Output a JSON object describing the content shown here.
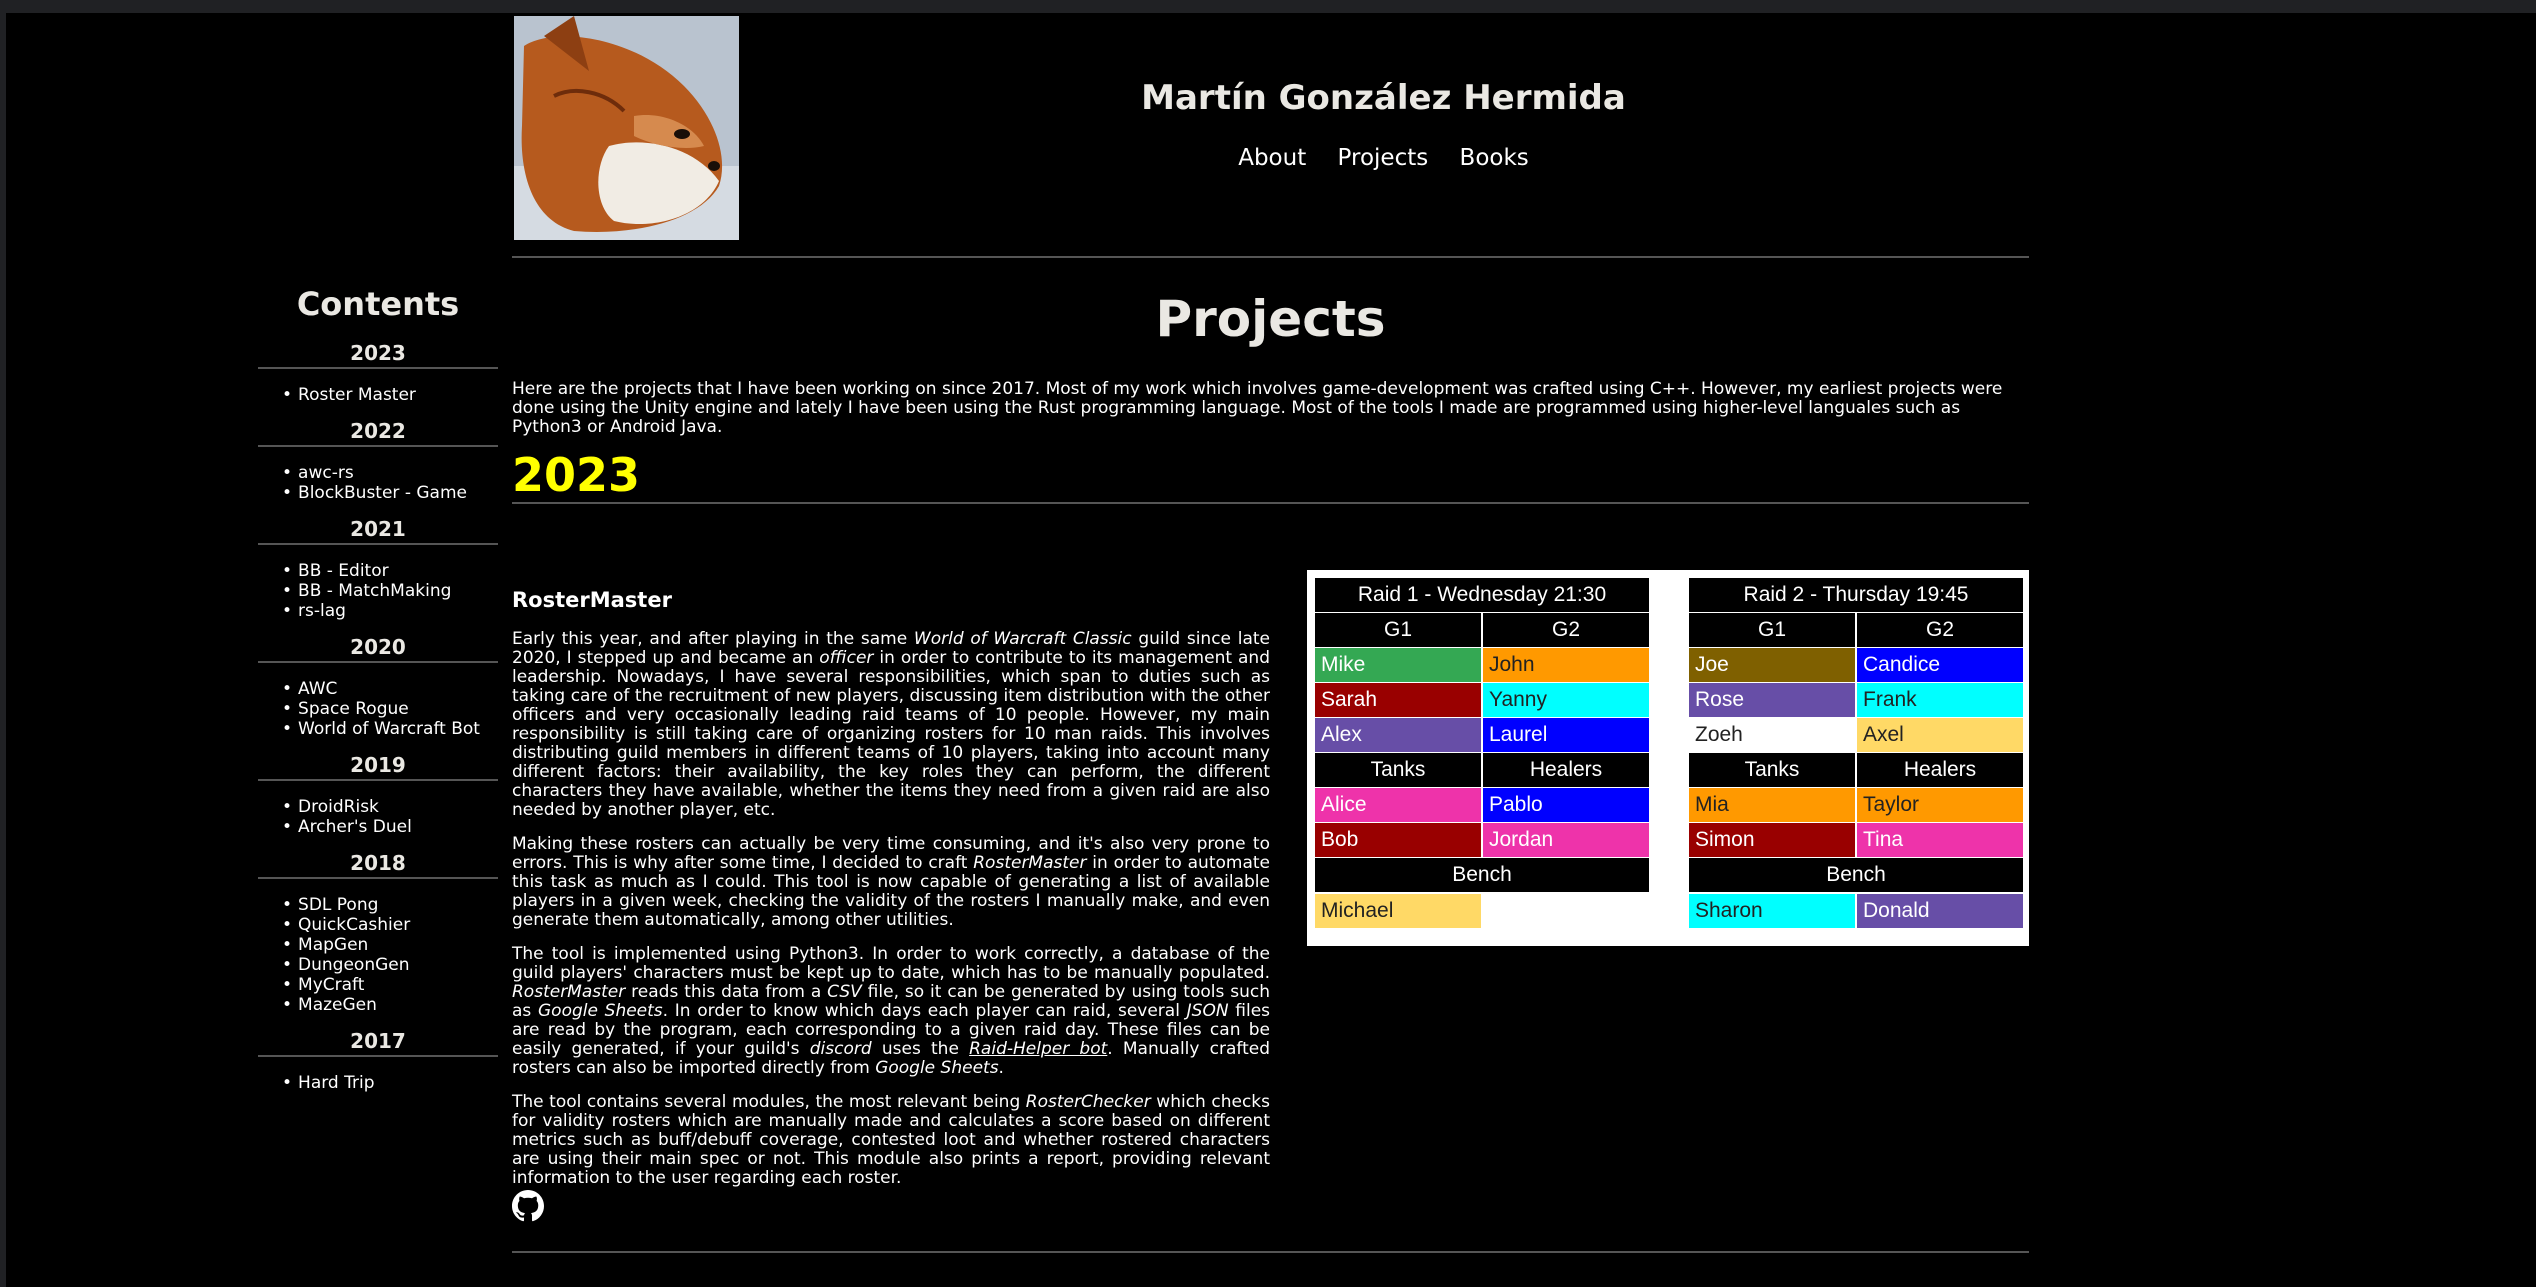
{
  "header": {
    "site_title": "Martín González Hermida",
    "nav": [
      "About",
      "Projects",
      "Books"
    ]
  },
  "sidebar": {
    "title": "Contents",
    "years": [
      {
        "year": "2023",
        "items": [
          "Roster Master"
        ]
      },
      {
        "year": "2022",
        "items": [
          "awc-rs",
          "BlockBuster - Game"
        ]
      },
      {
        "year": "2021",
        "items": [
          "BB - Editor",
          "BB - MatchMaking",
          "rs-lag"
        ]
      },
      {
        "year": "2020",
        "items": [
          "AWC",
          "Space Rogue",
          "World of Warcraft Bot"
        ]
      },
      {
        "year": "2019",
        "items": [
          "DroidRisk",
          "Archer's Duel"
        ]
      },
      {
        "year": "2018",
        "items": [
          "SDL Pong",
          "QuickCashier",
          "MapGen",
          "DungeonGen",
          "MyCraft",
          "MazeGen"
        ]
      },
      {
        "year": "2017",
        "items": [
          "Hard Trip"
        ]
      }
    ]
  },
  "main": {
    "title": "Projects",
    "intro": "Here are the projects that I have been working on since 2017. Most of my work which involves game-development was crafted using C++. However, my earliest projects were done using the Unity engine and lately I have been using the Rust programming language. Most of the tools I made are programmed using higher-level languales such as Python3 or Android Java.",
    "year_heading": "2023",
    "project": {
      "title": "RosterMaster",
      "p1": [
        "Early this year, and after playing in the same ",
        "World of Warcraft Classic",
        " guild since late 2020, I stepped up and became an ",
        "officer",
        " in order to contribute to its management and leadership. Nowadays, I have several responsibilities, which span to duties such as taking care of the recruitment of new players, discussing item distribution with the other officers and very occasionally leading raid teams of 10 people. However, my main responsibility is still taking care of organizing rosters for 10 man raids. This involves distributing guild members in different teams of 10 players, taking into account many different factors: their availability, the key roles they can perform, the different characters they have available, whether the items they need from a given raid are also needed by another player, etc."
      ],
      "p2": [
        "Making these rosters can actually be very time consuming, and it's also very prone to errors. This is why after some time, I decided to craft ",
        "RosterMaster",
        " in order to automate this task as much as I could. This tool is now capable of generating a list of available players in a given week, checking the validity of the rosters I manually make, and even generate them automatically, among other utilities."
      ],
      "p3": [
        "The tool is implemented using Python3. In order to work correctly, a database of the guild players' characters must be kept up to date, which has to be manually populated. ",
        "RosterMaster",
        " reads this data from a ",
        "CSV",
        " file, so it can be generated by using tools such as ",
        "Google Sheets",
        ". In order to know which days each player can raid, several ",
        "JSON",
        " files are read by the program, each corresponding to a given raid day. These files can be easily generated, if your guild's ",
        "discord",
        " uses the ",
        "Raid-Helper bot",
        ". Manually crafted rosters can also be imported directly from ",
        "Google Sheets",
        "."
      ],
      "p4": [
        "The tool contains several modules, the most relevant being ",
        "RosterChecker",
        " which checks for validity rosters which are manually made and calculates a score based on different metrics such as buff/debuff coverage, contested loot and whether rostered characters are using their main spec or not. This module also prints a report, providing relevant information to the user regarding each roster."
      ]
    }
  },
  "roster_image": {
    "raids": [
      {
        "title": "Raid 1 - Wednesday 21:30",
        "group_labels": [
          "G1",
          "G2"
        ],
        "groups": [
          [
            {
              "name": "Mike",
              "color": "#34a853"
            },
            {
              "name": "John",
              "color": "#ff9900"
            }
          ],
          [
            {
              "name": "Sarah",
              "color": "#990000"
            },
            {
              "name": "Yanny",
              "color": "#00ffff"
            }
          ],
          [
            {
              "name": "Alex",
              "color": "#674ea7"
            },
            {
              "name": "Laurel",
              "color": "#0000ff"
            }
          ]
        ],
        "role_labels": [
          "Tanks",
          "Healers"
        ],
        "roles": [
          [
            {
              "name": "Alice",
              "color": "#ee33aa"
            },
            {
              "name": "Pablo",
              "color": "#0000ff"
            }
          ],
          [
            {
              "name": "Bob",
              "color": "#990000"
            },
            {
              "name": "Jordan",
              "color": "#ee33aa"
            }
          ]
        ],
        "bench_label": "Bench",
        "bench": [
          {
            "name": "Michael",
            "color": "#ffd966"
          },
          {
            "name": "",
            "color": "#ffffff"
          }
        ]
      },
      {
        "title": "Raid 2 - Thursday 19:45",
        "group_labels": [
          "G1",
          "G2"
        ],
        "groups": [
          [
            {
              "name": "Joe",
              "color": "#7f6000"
            },
            {
              "name": "Candice",
              "color": "#0000ff"
            }
          ],
          [
            {
              "name": "Rose",
              "color": "#674ea7"
            },
            {
              "name": "Frank",
              "color": "#00ffff"
            }
          ],
          [
            {
              "name": "Zoeh",
              "color": "#ffffff"
            },
            {
              "name": "Axel",
              "color": "#ffd966"
            }
          ]
        ],
        "role_labels": [
          "Tanks",
          "Healers"
        ],
        "roles": [
          [
            {
              "name": "Mia",
              "color": "#ff9900"
            },
            {
              "name": "Taylor",
              "color": "#ff9900"
            }
          ],
          [
            {
              "name": "Simon",
              "color": "#990000"
            },
            {
              "name": "Tina",
              "color": "#ee33aa"
            }
          ]
        ],
        "bench_label": "Bench",
        "bench": [
          {
            "name": "Sharon",
            "color": "#00ffff"
          },
          {
            "name": "Donald",
            "color": "#674ea7"
          }
        ]
      }
    ]
  }
}
